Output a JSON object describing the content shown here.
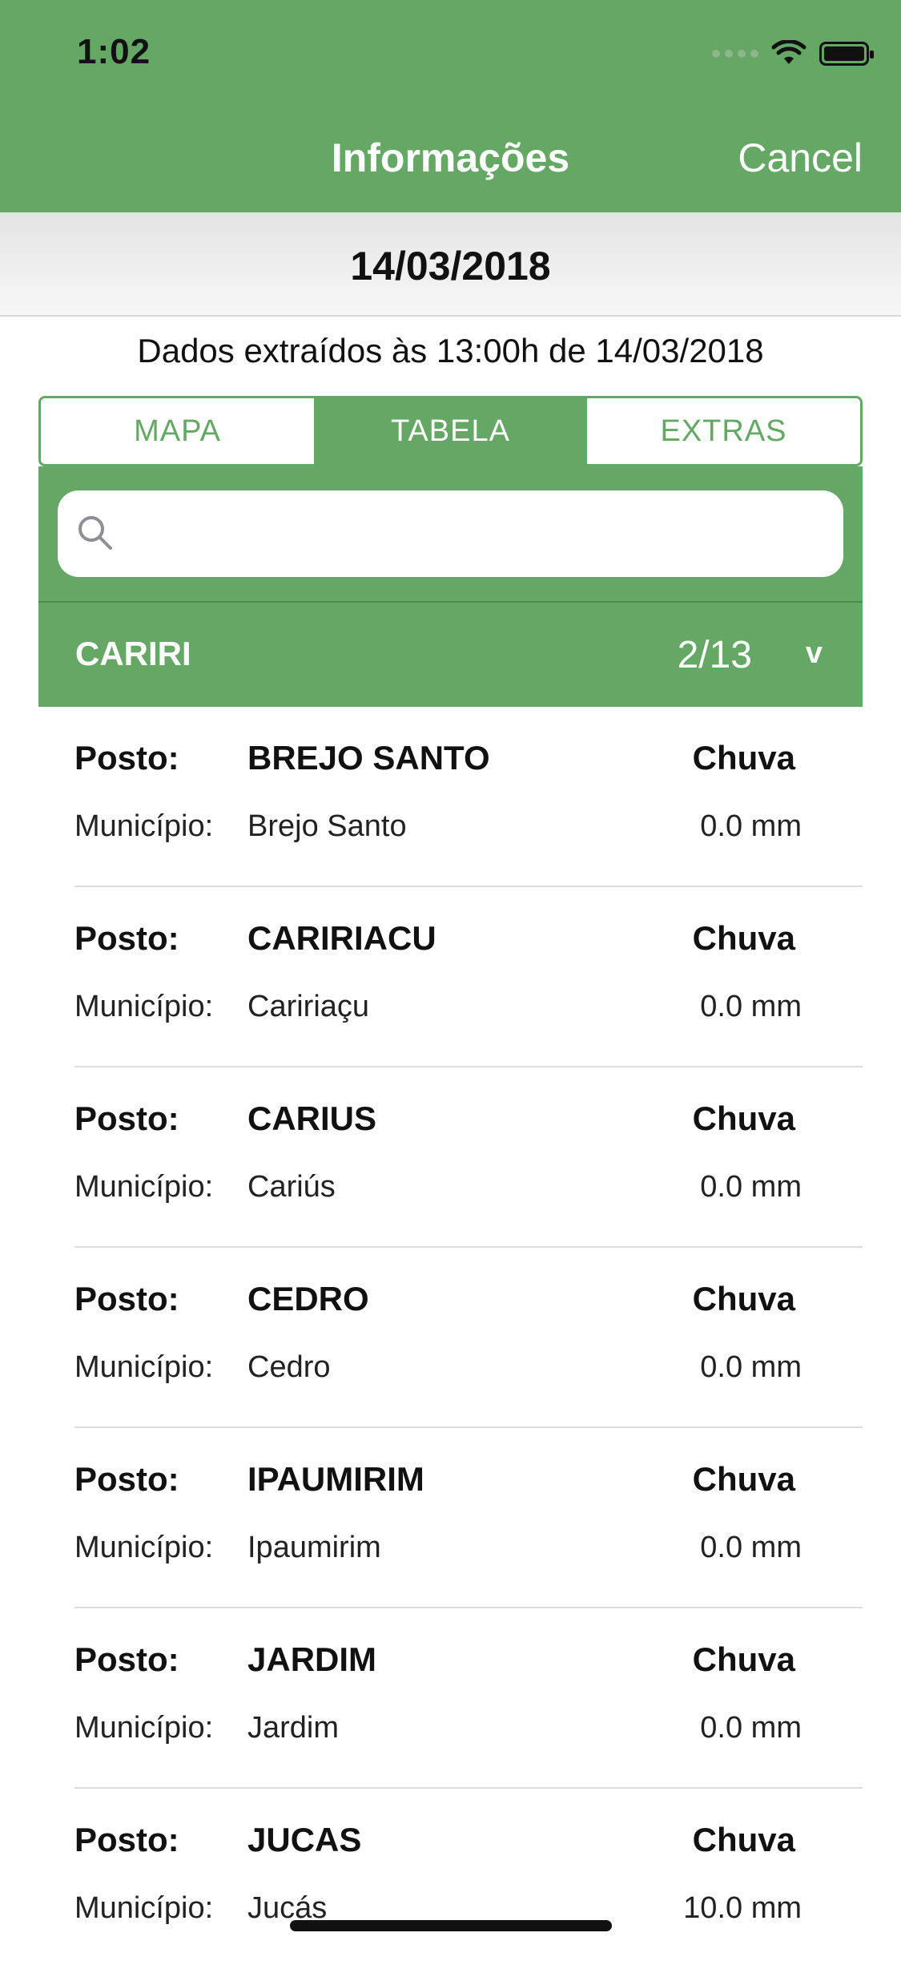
{
  "status_bar": {
    "time": "1:02"
  },
  "nav": {
    "title": "Informações",
    "cancel_label": "Cancel"
  },
  "date": "14/03/2018",
  "extract_note": "Dados extraídos às 13:00h de 14/03/2018",
  "tabs": [
    {
      "label": "MAPA",
      "active": false
    },
    {
      "label": "TABELA",
      "active": true
    },
    {
      "label": "EXTRAS",
      "active": false
    }
  ],
  "search": {
    "placeholder": "",
    "icon": "search-icon"
  },
  "group": {
    "name": "CARIRI",
    "count": "2/13",
    "chevron": "v"
  },
  "labels": {
    "posto": "Posto:",
    "municipio": "Município:",
    "chuva": "Chuva"
  },
  "rows": [
    {
      "posto": "BREJO SANTO",
      "municipio": "Brejo Santo",
      "chuva": "0.0 mm"
    },
    {
      "posto": "CARIRIACU",
      "municipio": "Caririaçu",
      "chuva": "0.0 mm"
    },
    {
      "posto": "CARIUS",
      "municipio": "Cariús",
      "chuva": "0.0 mm"
    },
    {
      "posto": "CEDRO",
      "municipio": "Cedro",
      "chuva": "0.0 mm"
    },
    {
      "posto": "IPAUMIRIM",
      "municipio": "Ipaumirim",
      "chuva": "0.0 mm"
    },
    {
      "posto": "JARDIM",
      "municipio": "Jardim",
      "chuva": "0.0 mm"
    },
    {
      "posto": "JUCAS",
      "municipio": "Jucás",
      "chuva": "10.0 mm"
    }
  ],
  "colors": {
    "brand_green": "#65a865"
  }
}
